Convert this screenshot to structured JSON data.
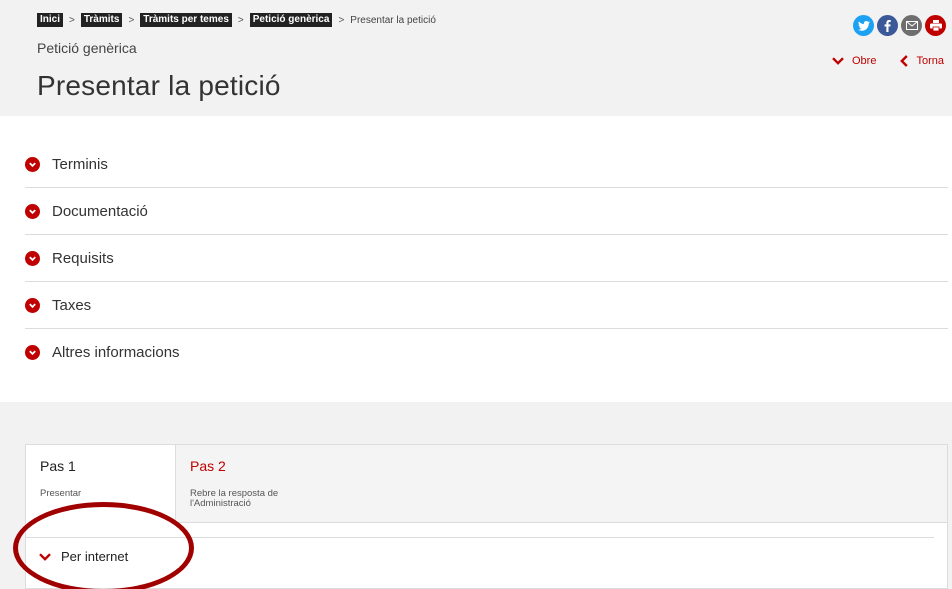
{
  "breadcrumb": {
    "items": [
      "Inici",
      "Tràmits",
      "Tràmits per temes",
      "Petició genèrica"
    ],
    "separator": ">",
    "current": "Presentar la petició"
  },
  "header": {
    "subtitle": "Petició genèrica",
    "title": "Presentar la petició"
  },
  "social": [
    "twitter-icon",
    "facebook-icon",
    "mail-icon",
    "print-icon"
  ],
  "actions": {
    "open_label": "Obre",
    "back_label": "Torna"
  },
  "accordion": {
    "items": [
      "Terminis",
      "Documentació",
      "Requisits",
      "Taxes",
      "Altres informacions"
    ]
  },
  "steps": {
    "tabs": [
      {
        "title": "Pas 1",
        "desc_line1": "Presentar",
        "desc_line2": ""
      },
      {
        "title": "Pas 2",
        "desc_line1": "Rebre la resposta de",
        "desc_line2": "l'Administració"
      }
    ],
    "channel_label": "Per internet"
  },
  "colors": {
    "accent": "#c00000",
    "header_bg": "#f2f2f2",
    "annotation": "#a00000"
  }
}
